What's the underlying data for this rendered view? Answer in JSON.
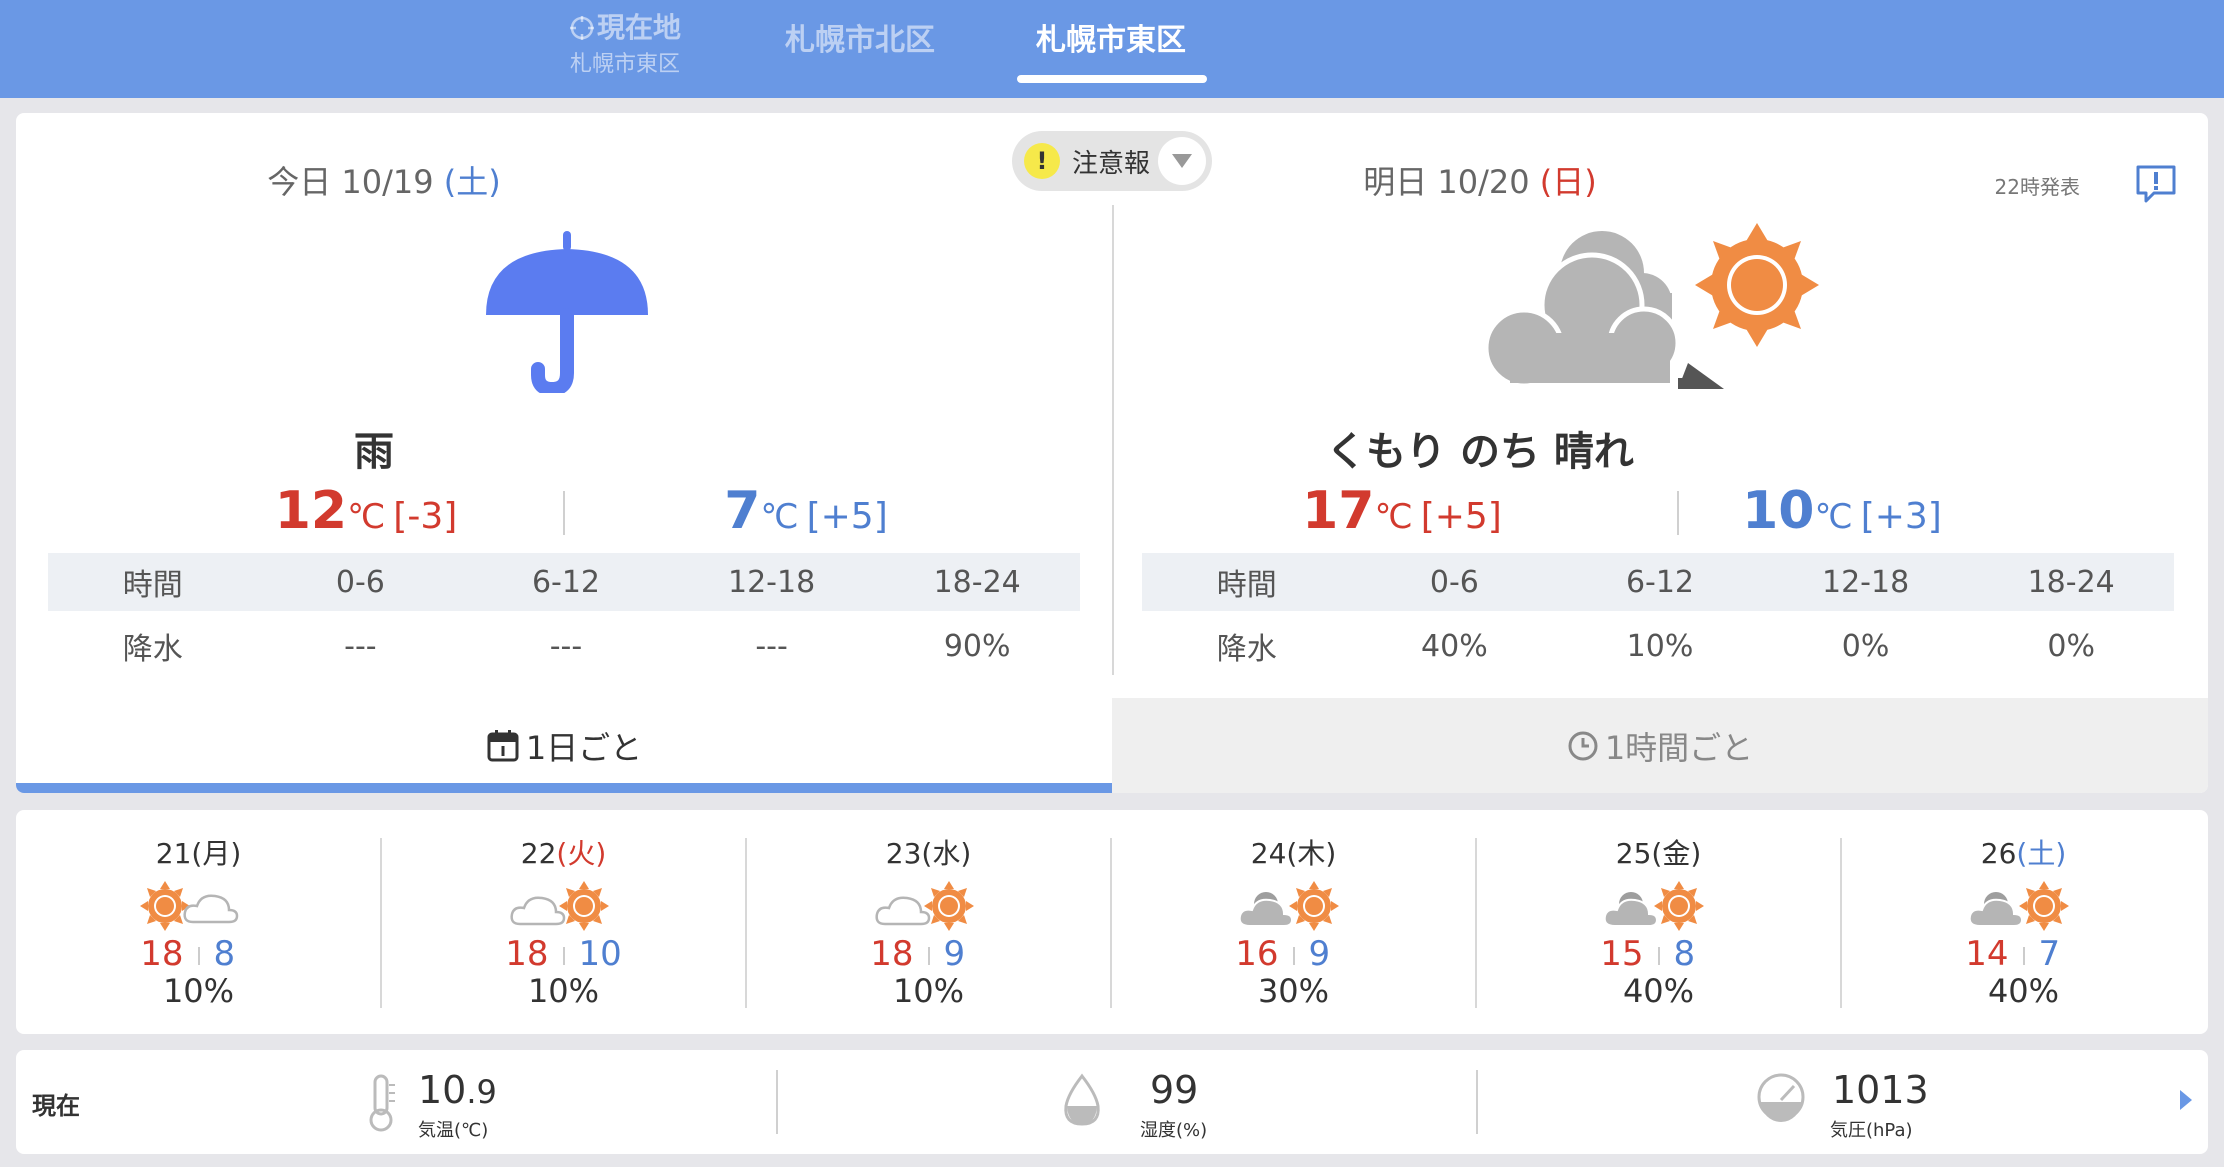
{
  "header": {
    "tabs": [
      {
        "label": "現在地",
        "sub": "札幌市東区"
      },
      {
        "label": "札幌市北区"
      },
      {
        "label": "札幌市東区"
      }
    ],
    "selected_tab": "札幌市東区"
  },
  "warning": {
    "label": "注意報"
  },
  "issue_time": "22時発表",
  "today": {
    "date_prefix": "今日 10/19 ",
    "weekday": "(土)",
    "weather_icon": "umbrella-icon",
    "weather": "雨",
    "high": "12",
    "high_unit": "℃",
    "high_diff": "[-3]",
    "low": "7",
    "low_unit": "℃",
    "low_diff": "[+5]",
    "rain": {
      "head": [
        "時間",
        "0-6",
        "6-12",
        "12-18",
        "18-24"
      ],
      "vals": [
        "降水",
        "---",
        "---",
        "---",
        "90%"
      ]
    }
  },
  "tomorrow": {
    "date_prefix": "明日 10/20 ",
    "weekday": "(日)",
    "weather_icon": "cloudy-then-sunny-icon",
    "weather": "くもり のち 晴れ",
    "high": "17",
    "high_unit": "℃",
    "high_diff": "[+5]",
    "low": "10",
    "low_unit": "℃",
    "low_diff": "[+3]",
    "rain": {
      "head": [
        "時間",
        "0-6",
        "6-12",
        "12-18",
        "18-24"
      ],
      "vals": [
        "降水",
        "40%",
        "10%",
        "0%",
        "0%"
      ]
    }
  },
  "modes": {
    "daily": "1日ごと",
    "hourly": "1時間ごと",
    "selected": "daily"
  },
  "weekly": [
    {
      "day": "21",
      "wd": "(月)",
      "wd_color": "normal",
      "icon": "sunny-then-cloudy-icon",
      "hi": "18",
      "lo": "8",
      "pop": "10%"
    },
    {
      "day": "22",
      "wd": "(火)",
      "wd_color": "red",
      "icon": "cloudy-then-sunny-icon",
      "hi": "18",
      "lo": "10",
      "pop": "10%"
    },
    {
      "day": "23",
      "wd": "(水)",
      "wd_color": "normal",
      "icon": "cloudy-then-sunny-icon",
      "hi": "18",
      "lo": "9",
      "pop": "10%"
    },
    {
      "day": "24",
      "wd": "(木)",
      "wd_color": "normal",
      "icon": "cloudy-then-sunny-icon",
      "hi": "16",
      "lo": "9",
      "pop": "30%"
    },
    {
      "day": "25",
      "wd": "(金)",
      "wd_color": "normal",
      "icon": "cloudy-then-sunny-icon",
      "hi": "15",
      "lo": "8",
      "pop": "40%"
    },
    {
      "day": "26",
      "wd": "(土)",
      "wd_color": "blue",
      "icon": "cloudy-then-sunny-icon",
      "hi": "14",
      "lo": "7",
      "pop": "40%"
    }
  ],
  "current": {
    "label": "現在",
    "temp_int": "10",
    "temp_dec": ".9",
    "temp_cap": "気温(℃)",
    "humidity": "99",
    "humidity_cap": "湿度(%)",
    "pressure": "1013",
    "pressure_cap": "気圧(hPa)"
  },
  "colors": {
    "accent": "#6a98e5",
    "high_temp": "#d23a2e",
    "low_temp": "#4f7fd0",
    "sun": "#f08c44",
    "cloud": "#b5b5b5"
  }
}
